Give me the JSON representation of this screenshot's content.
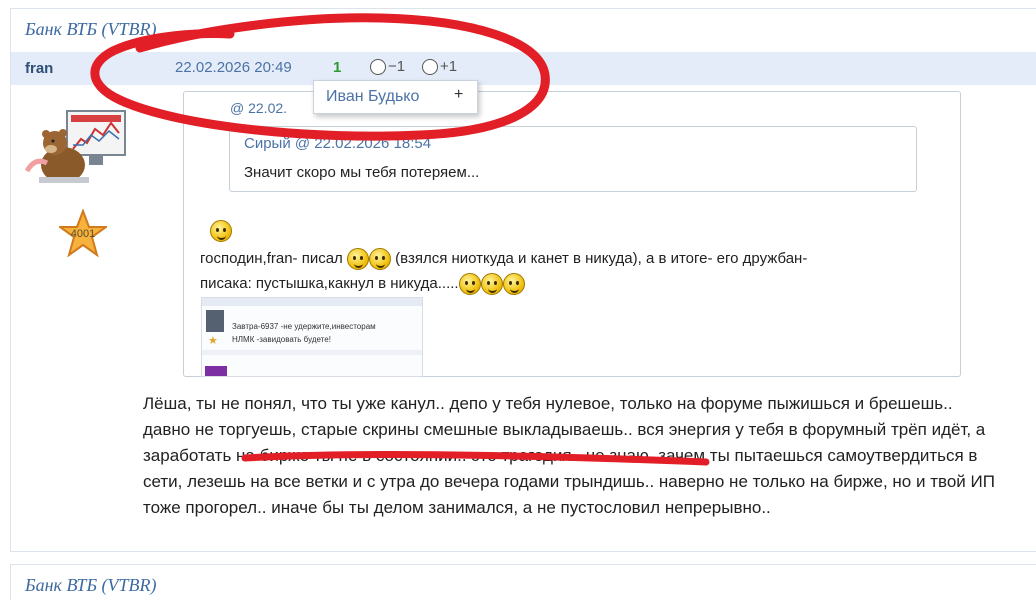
{
  "post": {
    "forum_title": "Банк ВТБ (VTBR)",
    "author": "fran",
    "date": "22.02.2026 20:49",
    "rating": "1",
    "vote_minus": "−1",
    "vote_plus": "+1",
    "avatar_icon": "trader-bear-avatar",
    "badge_count": "4001"
  },
  "dropdown": {
    "item_label": "Иван Будько",
    "item_action": "+"
  },
  "quote_outer": {
    "header": "@ 22.02."
  },
  "quote_inner": {
    "header": "Сирый @ 22.02.2026 18:54",
    "text": "Значит скоро мы тебя потеряем..."
  },
  "quote_body": {
    "line1_a": "господин,fran- писал",
    "line1_b": "(взялся ниоткуда и канет в никуда), а в итоге- его дружбан-",
    "line2": "писака: пустышка,какнул в никуда....."
  },
  "thumbnail": {
    "line1": "Завтра-6937 -не удержите,инвесторам",
    "line2": "НЛМК -завидовать будете!"
  },
  "reply_text": "Лёша, ты не понял, что ты уже канул.. депо у тебя нулевое, только на форуме пыжишься и брешешь.. давно не торгуешь, старые скрины смешные выкладываешь.. вся энергия у тебя в форумный трёп идёт, а заработать на бирже ты не в состоянии.. это трагедия.. не знаю, зачем ты пытаешься самоутвердиться в сети, лезешь на все ветки и с утра до вечера годами трындишь.. наверно не только на бирже, но и твой ИП тоже прогорел.. иначе бы ты делом занимался, а не пустословил непрерывно..",
  "next_post": {
    "forum_title": "Банк ВТБ (VTBR)"
  },
  "colors": {
    "link": "#4c73a5",
    "author_bar": "#e3ecf8",
    "rating_green": "#2f9a35",
    "scribble_red": "#e21f26"
  }
}
